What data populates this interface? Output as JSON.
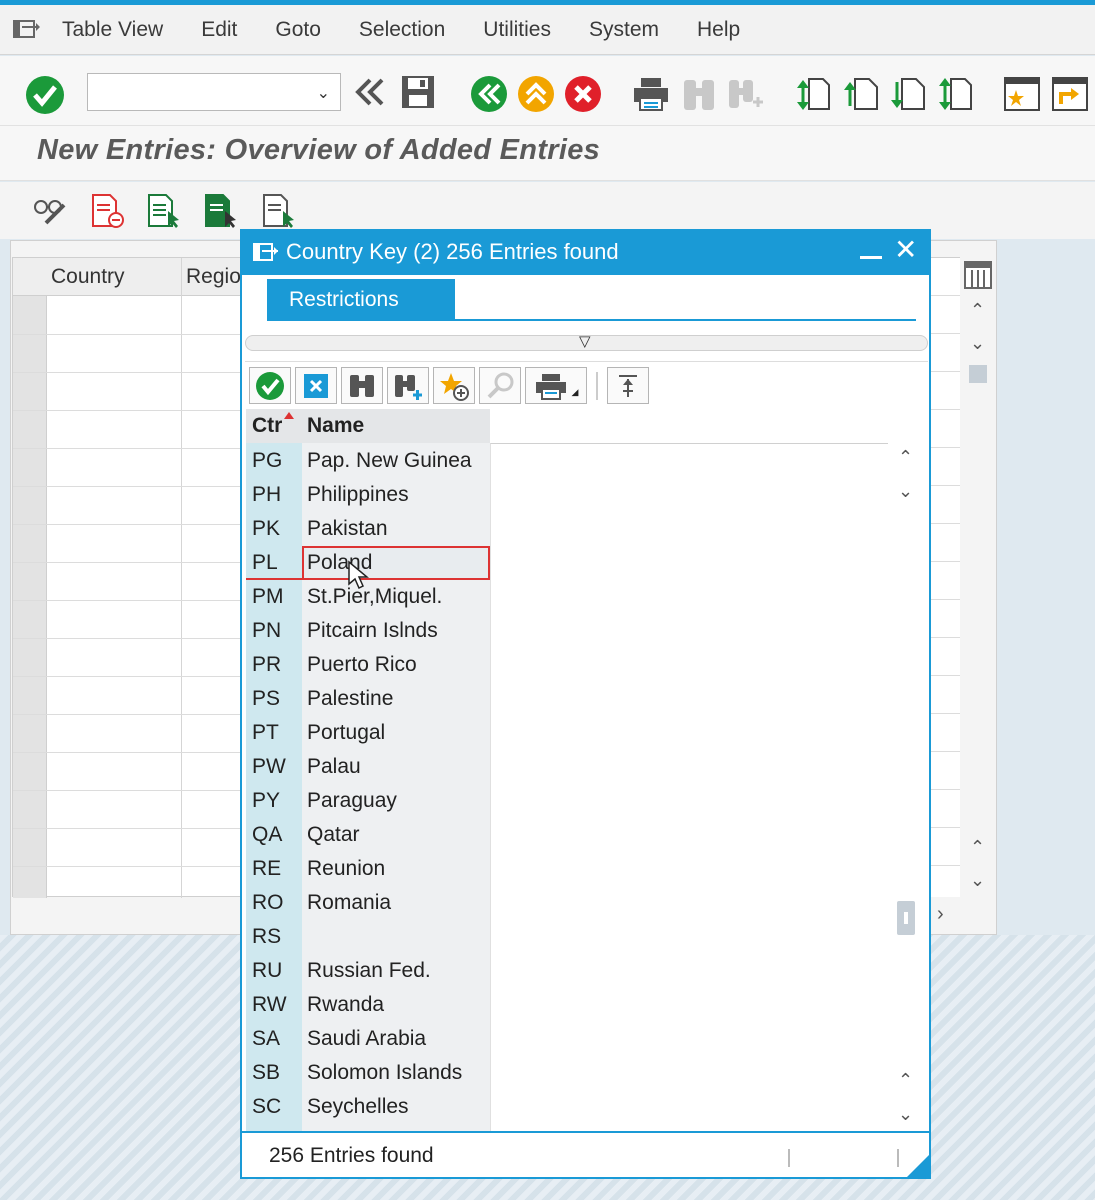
{
  "menu": {
    "items": [
      "Table View",
      "Edit",
      "Goto",
      "Selection",
      "Utilities",
      "System",
      "Help"
    ]
  },
  "toolbar": {
    "command_field_value": ""
  },
  "page": {
    "title": "New Entries: Overview of Added Entries"
  },
  "table": {
    "col_country": "Country",
    "col_region": "Regio"
  },
  "dialog": {
    "title": "Country Key (2)  256 Entries found",
    "tab_restrictions": "Restrictions",
    "col_ctr": "Ctr",
    "col_name": "Name",
    "footer_status": "256 Entries found",
    "rows": [
      {
        "code": "PG",
        "name": "Pap. New Guinea"
      },
      {
        "code": "PH",
        "name": "Philippines"
      },
      {
        "code": "PK",
        "name": "Pakistan"
      },
      {
        "code": "PL",
        "name": "Poland"
      },
      {
        "code": "PM",
        "name": "St.Pier,Miquel."
      },
      {
        "code": "PN",
        "name": "Pitcairn Islnds"
      },
      {
        "code": "PR",
        "name": "Puerto Rico"
      },
      {
        "code": "PS",
        "name": "Palestine"
      },
      {
        "code": "PT",
        "name": "Portugal"
      },
      {
        "code": "PW",
        "name": "Palau"
      },
      {
        "code": "PY",
        "name": "Paraguay"
      },
      {
        "code": "QA",
        "name": "Qatar"
      },
      {
        "code": "RE",
        "name": "Reunion"
      },
      {
        "code": "RO",
        "name": "Romania"
      },
      {
        "code": "RS",
        "name": ""
      },
      {
        "code": "RU",
        "name": "Russian Fed."
      },
      {
        "code": "RW",
        "name": "Rwanda"
      },
      {
        "code": "SA",
        "name": "Saudi Arabia"
      },
      {
        "code": "SB",
        "name": "Solomon Islands"
      },
      {
        "code": "SC",
        "name": "Seychelles"
      }
    ]
  },
  "colors": {
    "accent": "#1a9ad6",
    "selection_border": "#dd3333",
    "code_column_bg": "#cfe8ef"
  }
}
